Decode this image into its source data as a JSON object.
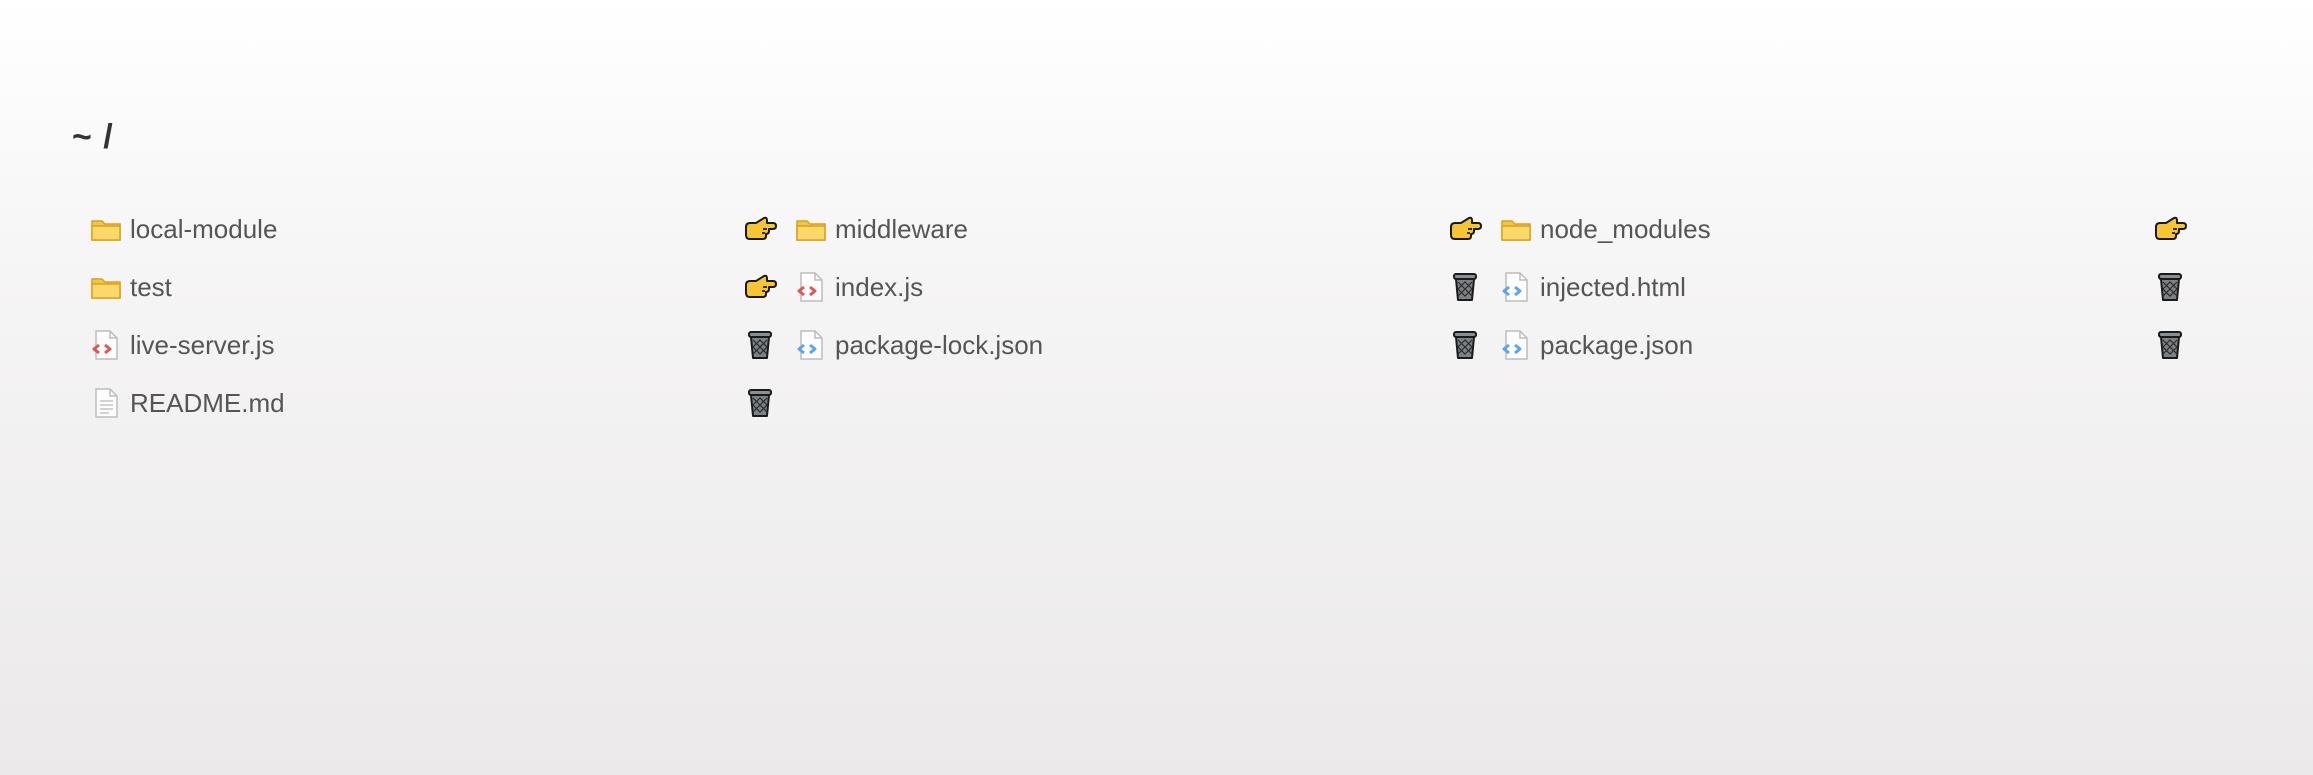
{
  "header": {
    "title": "~ /"
  },
  "entries": [
    {
      "name": "local-module",
      "kind": "folder",
      "action_icon": "pointing-hand-icon"
    },
    {
      "name": "middleware",
      "kind": "folder",
      "action_icon": "pointing-hand-icon"
    },
    {
      "name": "node_modules",
      "kind": "folder",
      "action_icon": "pointing-hand-icon"
    },
    {
      "name": "test",
      "kind": "folder",
      "action_icon": "pointing-hand-icon"
    },
    {
      "name": "index.js",
      "kind": "js-file",
      "action_icon": "trash-can-icon"
    },
    {
      "name": "injected.html",
      "kind": "code-file",
      "action_icon": "trash-can-icon"
    },
    {
      "name": "live-server.js",
      "kind": "js-file",
      "action_icon": "trash-can-icon"
    },
    {
      "name": "package-lock.json",
      "kind": "code-file",
      "action_icon": "trash-can-icon"
    },
    {
      "name": "package.json",
      "kind": "code-file",
      "action_icon": "trash-can-icon"
    },
    {
      "name": "README.md",
      "kind": "text-file",
      "action_icon": "trash-can-icon"
    }
  ],
  "colors": {
    "folder": "#f5c445",
    "js_arrows": "#e05555",
    "code_arrows": "#5aa7e8",
    "hand": "#f7c531",
    "trash": "#7c8186"
  }
}
